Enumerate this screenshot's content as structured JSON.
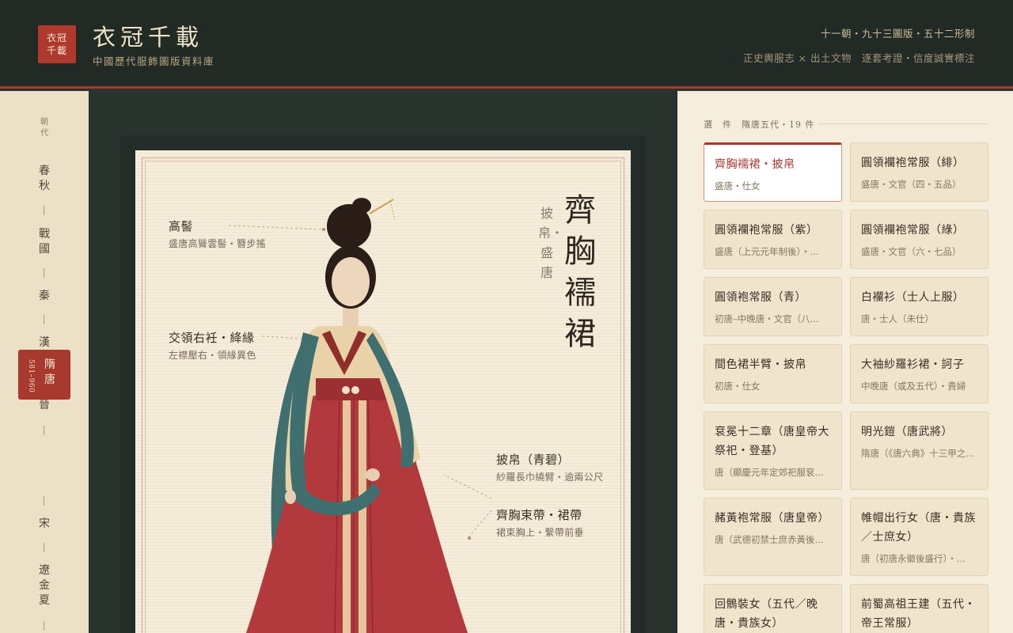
{
  "header": {
    "logo_line1": "衣冠",
    "logo_line2": "千載",
    "title": "衣冠千載",
    "subtitle": "中國歷代服飾圖版資料庫",
    "meta1": "十一朝・九十三圖版・五十二形制",
    "meta2": "正史輿服志 × 出土文物　逐套考證・信度誠實標注"
  },
  "nav": {
    "label_1": "朝",
    "label_2": "代",
    "items": [
      "春\n秋",
      "戰\n國",
      "秦",
      "漢",
      "魏\n晉",
      "隋\n唐",
      "宋",
      "遼\n金\n夏"
    ],
    "active": {
      "name_1": "隋",
      "name_2": "唐",
      "years": "581–960"
    }
  },
  "plate": {
    "title": "齊胸襦裙",
    "subtitle": "披帛・盛唐",
    "annotations": [
      {
        "title": "高髻",
        "desc": "盛唐高聳雲髻・簪步搖"
      },
      {
        "title": "交領右衽・絳緣",
        "desc": "左襟壓右・領緣異色"
      },
      {
        "title": "披帛（青碧）",
        "desc": "紗羅長巾繞臂・逾兩公尺"
      },
      {
        "title": "齊胸束帶・裙帶",
        "desc": "裙束胸上・繫帶前垂"
      }
    ]
  },
  "side": {
    "heading": "選　件",
    "count": "隋唐五代・19 件",
    "cards": [
      {
        "title": "齊胸襦裙・披帛",
        "meta": "盛唐・仕女",
        "selected": true
      },
      {
        "title": "圓領襴袍常服（緋）",
        "meta": "盛唐・文官（四・五品）"
      },
      {
        "title": "圓領襴袍常服（紫）",
        "meta": "盛唐（上元元年制後）・..."
      },
      {
        "title": "圓領襴袍常服（綠）",
        "meta": "盛唐・文官（六・七品）"
      },
      {
        "title": "圓領袍常服（青）",
        "meta": "初唐–中晚唐・文官（八..."
      },
      {
        "title": "白襴衫（士人上服）",
        "meta": "唐・士人（未仕）"
      },
      {
        "title": "間色裙半臂・披帛",
        "meta": "初唐・仕女"
      },
      {
        "title": "大袖紗羅衫裙・訶子",
        "meta": "中晚唐（或及五代）・貴婦"
      },
      {
        "title": "袞冕十二章（唐皇帝大祭祀・登基）",
        "meta": "唐（顯慶元年定郊祀服袞..."
      },
      {
        "title": "明光鎧（唐武將）",
        "meta": "隋唐（《唐六典》十三甲之..."
      },
      {
        "title": "赭黃袍常服（唐皇帝）",
        "meta": "唐（武德初禁士庶赤黃後..."
      },
      {
        "title": "帷帽出行女（唐・貴族／士庶女）",
        "meta": "唐（初唐永徽後盛行）・..."
      },
      {
        "title": "回鶻裝女（五代／晚唐・貴族女）",
        "meta": ""
      },
      {
        "title": "前蜀高祖王建（五代・帝王常服）",
        "meta": ""
      }
    ]
  },
  "colors": {
    "accent": "#a8392e",
    "header_bg": "#212a25",
    "panel_bg": "#f6eedd",
    "plate_bg": "#f5ecd9"
  }
}
